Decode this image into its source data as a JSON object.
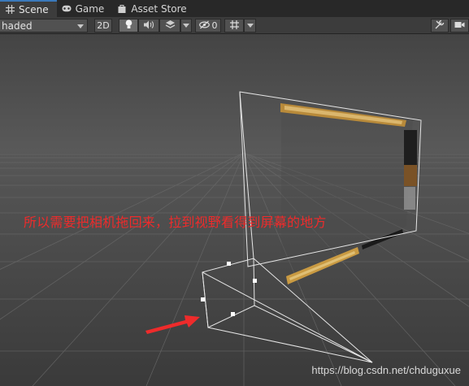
{
  "tabs": [
    {
      "label": "Scene",
      "icon": "grid-icon",
      "active": true
    },
    {
      "label": "Game",
      "icon": "gamepad-icon",
      "active": false
    },
    {
      "label": "Asset Store",
      "icon": "shopping-bag-icon",
      "active": false
    }
  ],
  "toolbar": {
    "shading_mode": "haded",
    "mode_2d": "2D",
    "hidden_count": "0"
  },
  "annotation": "所以需要把相机拖回来，拉到视野看得到屏幕的地方",
  "watermark": "https://blog.csdn.net/chduguxue",
  "colors": {
    "annotation": "#ee2b2b",
    "tab_active_accent": "#3a79bb",
    "arrow": "#ee2b2b"
  }
}
